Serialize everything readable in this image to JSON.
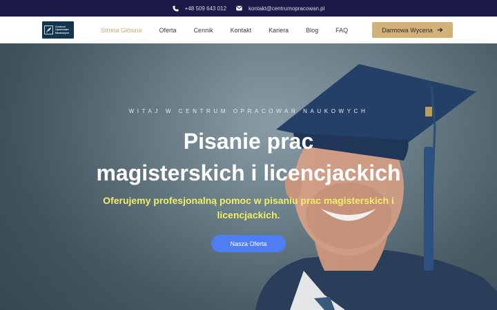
{
  "topbar": {
    "phone_icon": "phone-icon",
    "phone": "+48 509 643 012",
    "email_icon": "envelope-icon",
    "email": "kontakt@centrumopracowan.pl"
  },
  "logo": {
    "line1": "Centrum",
    "line2": "Opracowań",
    "line3": "Naukowych"
  },
  "nav": {
    "items": [
      {
        "label": "Strona Główna",
        "active": true
      },
      {
        "label": "Oferta"
      },
      {
        "label": "Cennik"
      },
      {
        "label": "Kontakt"
      },
      {
        "label": "Kariera"
      },
      {
        "label": "Blog"
      },
      {
        "label": "FAQ"
      }
    ]
  },
  "header_cta": {
    "label": "Darmowa Wycena",
    "icon": "arrow-right-icon"
  },
  "hero": {
    "kicker": "WITAJ W CENTRUM OPRACOWAŃ NAUKOWYCH",
    "title_line1": "Pisanie prac",
    "title_line2": "magisterskich i licencjackich",
    "subtitle": "Oferujemy profesjonalną pomoc w pisaniu prac magisterskich i licencjackich.",
    "cta": "Nasza Oferta"
  },
  "colors": {
    "topbar_bg": "#1b1a47",
    "nav_active": "#c9ab77",
    "header_cta_bg": "#d3b27a",
    "subtitle": "#f3ee62",
    "hero_cta_bg": "#4f7df2"
  }
}
